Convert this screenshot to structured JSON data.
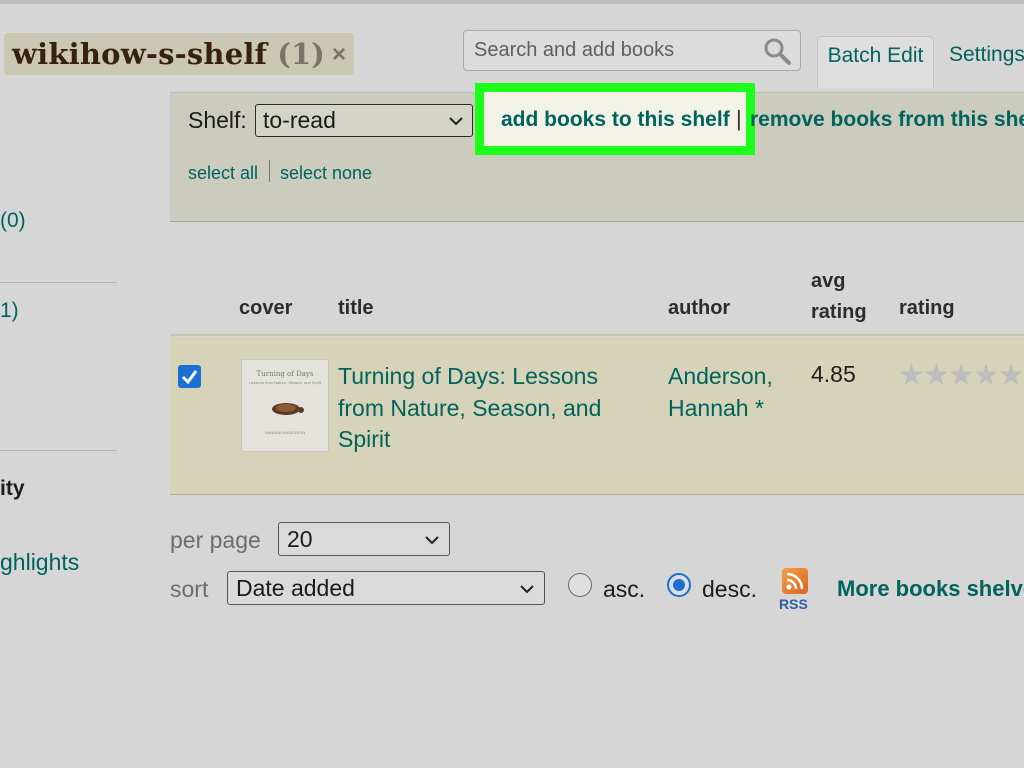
{
  "shelf": {
    "name": "wikihow-s-shelf",
    "count": "(1)",
    "close": "×"
  },
  "search": {
    "placeholder": "Search and add books"
  },
  "tabs": {
    "batch_edit": "Batch Edit",
    "settings": "Settings"
  },
  "batch": {
    "shelf_label": "Shelf:",
    "shelf_value": "to-read",
    "add_link": "add books to this shelf",
    "separator": "|",
    "remove_link": "remove books from this shelf",
    "select_all": "select all",
    "select_none": "select none"
  },
  "sidebar": {
    "count_0": "(0)",
    "count_1": "1)",
    "section": "ity",
    "highlights": "ghlights"
  },
  "table": {
    "headers": {
      "cover": "cover",
      "title": "title",
      "author": "author",
      "avg_line1": "avg",
      "avg_line2": "rating",
      "rating": "rating"
    },
    "rows": [
      {
        "checked": true,
        "cover_title": "Turning of Days",
        "cover_subtitle": "Lessons from Nature, Season, and Spirit",
        "cover_author": "HANNAH ANDERSON",
        "title": "Turning of Days: Lessons from Nature, Season, and Spirit",
        "author": "Anderson, Hannah *",
        "avg_rating": "4.85",
        "stars": "★★★★★"
      }
    ]
  },
  "controls": {
    "per_page_label": "per page",
    "per_page_value": "20",
    "sort_label": "sort",
    "sort_value": "Date added",
    "asc": "asc.",
    "desc": "desc.",
    "order_selected": "desc",
    "rss": "RSS",
    "more_link": "More books shelved"
  },
  "colors": {
    "link": "#00635d",
    "highlight": "#1bff1b",
    "checkbox": "#1a6fd3"
  }
}
